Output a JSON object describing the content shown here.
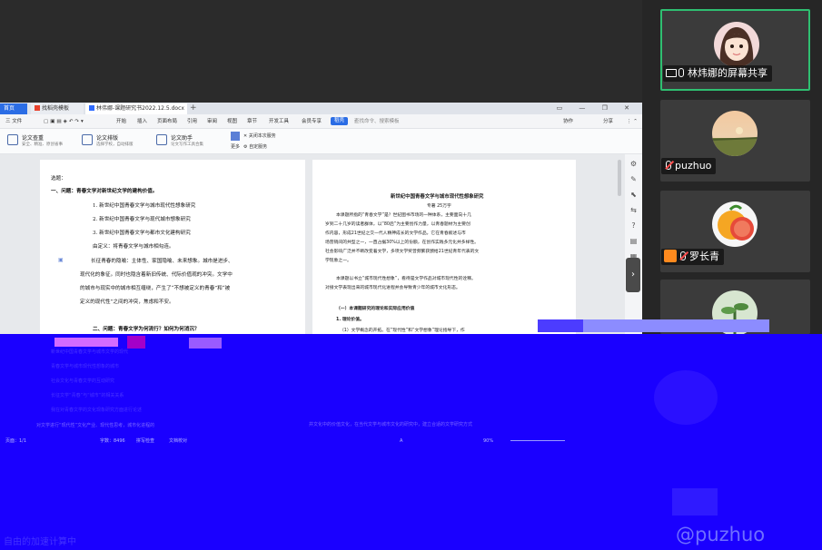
{
  "wps": {
    "tabs": {
      "home": "首页",
      "file2": "找稻壳模板",
      "file3": "林伟娜-课题研究书2022.12.5.docx"
    },
    "menu": {
      "file": "三 文件",
      "items": [
        "开始",
        "插入",
        "页面布局",
        "引用",
        "审阅",
        "视图",
        "章节",
        "开发工具",
        "会员专享"
      ],
      "active": "稻壳",
      "search": "查找命令、搜索模板",
      "collab": "协作",
      "share": "分享"
    },
    "ribbon": {
      "btn1_label": "论文查重",
      "btn1_sub": "安全、精准、原创省事",
      "btn2_label": "论文排版",
      "btn2_sub": "选择学校，自动排版",
      "btn3_label": "论文助手",
      "btn3_sub": "论文写作工具合集",
      "close": "关闭本次服务",
      "more": "更多",
      "settings": "自定服务"
    },
    "page1": {
      "lines": [
        "选题：",
        "一、问题：青春文学对新世纪文学的建构价值。",
        "1. 新世纪中国青春文学与城市现代性想象研究",
        "2. 新世纪中国青春文学与现代城市想象研究",
        "3. 新世纪中国青春文学与都市文化建构研究",
        "由定义：将青春文学与城市相勾连。",
        "长征青春的隐喻：主体性、家国隐喻、未来想象。城市是进步、",
        "现代化的象征。同时也隐含着新旧传统、代际价值观的冲突。文学中",
        "的城市与现实中的城市相互缠绕，产生了“不想被定义的青春”和“被",
        "定义的现代性”之间的冲突，焦虑和不安。",
        "二、问题：青春文学为何流行？如何为何消沉？"
      ]
    },
    "page2": {
      "title": "新世纪中国青春文学与城市现代性想象研究",
      "subtitle": "专著 25万字",
      "para1": [
        "本课题所指的“青春文学”是？世纪图书市场的一种体系，主要面向十几",
        "岁到二十几岁的读者群体，以“80后”为主要创作力量，以青春题材为主要创",
        "作内容，形成21世纪之交一代人精神成长的文学作品，它在青春叙述与市",
        "场营销间的共型之一，一直占据30%以上的份额，在创作实践多元化并多样性。",
        "社会影响广泛并不断改变着文学，多项文学奖曾频繁获颁给21世纪青年代表的文",
        "学现象之一。"
      ],
      "para2": [
        "本课题以书立“城市现代性想象”，看待是文学作品对城市现代性的诠释。",
        "对接文学表现出来的城市现代化进程并会导致青少年的城市文化形态。"
      ],
      "section": "（一）本课题研究的理论和实际应用价值",
      "sub1": "1. 理论价值。",
      "item1": "（1）文学概念的开拓。在“现代性”和“文学想象”理论指导下，作"
    },
    "ghost_lines": [
      "新世纪中国青春文学与城市文学的现代",
      "青春文学与城市现代性想象的城市",
      "社会文化与青春文学的互动研究",
      "长征文学“青春”与“城市”的相关关系",
      "我在对青春文学的文化现象研究方面进行论述",
      "对文学进行“现代性”文化产业、现代性思考，城市化进程的",
      "并文化中的价值文化，在当代文学与城市文化的研究中，建立合适的文学研究方式"
    ],
    "statusbar": {
      "page": "页面：1/1",
      "words": "字数：8496",
      "spell": "拼写检查",
      "proofing": "文档校对",
      "view": "A",
      "zoom": "90%"
    }
  },
  "participants": [
    {
      "name": "林炜娜的屏幕共享",
      "active": true,
      "mic": "on",
      "badge": "screen",
      "avatar": "cartoon-girl"
    },
    {
      "name": "puzhuo",
      "active": false,
      "mic": "muted",
      "badge": "none",
      "avatar": "landscape"
    },
    {
      "name": "罗长青",
      "active": false,
      "mic": "muted",
      "badge": "person",
      "avatar": "grapefruit"
    },
    {
      "name": "",
      "active": false,
      "mic": "none",
      "badge": "none",
      "avatar": "plant"
    }
  ],
  "watermark": "@puzhuo",
  "watermark_left": "自由的加速计算中"
}
